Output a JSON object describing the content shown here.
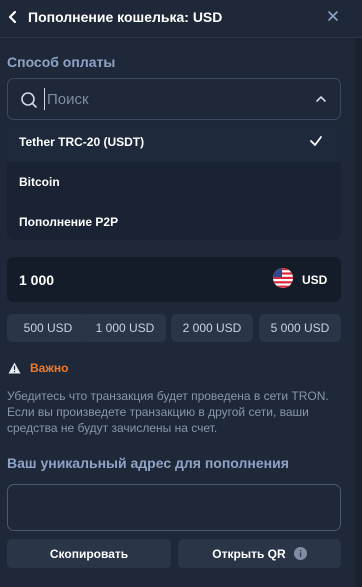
{
  "header": {
    "title": "Пополнение кошелька: USD"
  },
  "payment": {
    "section_label": "Способ оплаты",
    "search_placeholder": "Поиск",
    "options": [
      {
        "label": "Tether TRC-20 (USDT)",
        "selected": true
      },
      {
        "label": "Bitcoin",
        "selected": false
      },
      {
        "label": "Пополнение P2P",
        "selected": false
      }
    ]
  },
  "amount": {
    "value": "1 000",
    "currency": "USD",
    "flag": "us-flag-icon",
    "presets": [
      "500 USD",
      "1 000 USD",
      "2 000 USD",
      "5 000 USD"
    ]
  },
  "warning": {
    "title": "Важно",
    "text": "Убедитесь что транзакция будет проведена в сети TRON. Если вы произведете транзакцию в другой сети, ваши средства не будут зачислены на счет.",
    "color": "#f07a2a"
  },
  "address": {
    "label": "Ваш уникальный адрес для пополнения",
    "value": ""
  },
  "actions": {
    "copy_label": "Скопировать",
    "qr_label": "Открыть QR"
  },
  "colors": {
    "background": "#1f2838",
    "accent_label": "#8ea3c5",
    "button": "#2a3547"
  }
}
